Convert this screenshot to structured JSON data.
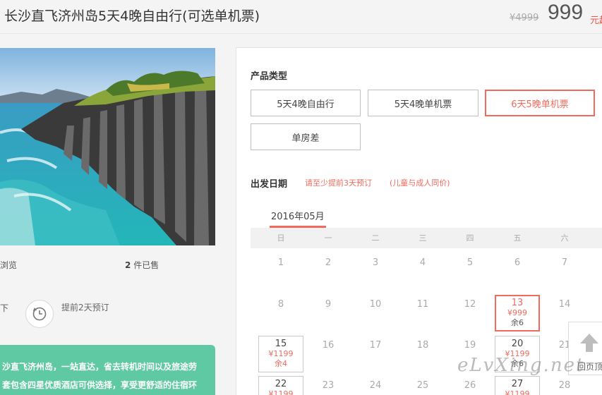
{
  "header": {
    "title": "长沙直飞济州岛5天4晚自由行(可选单机票)",
    "original_price": "¥4999",
    "price": "999",
    "price_unit": "元起"
  },
  "stats": {
    "views_label": "浏览",
    "sold_count": "2",
    "sold_label": "件已售",
    "cut_text": "下",
    "advance_text": "提前2天预订"
  },
  "description": {
    "line1": "沙直飞济州岛，一站直达，省去转机时间以及旅途劳",
    "line2": "套包含四星优质酒店可供选择，享受更舒适的住宿环"
  },
  "product": {
    "label": "产品类型",
    "options": [
      {
        "label": "5天4晚自由行",
        "selected": false
      },
      {
        "label": "5天4晚单机票",
        "selected": false
      },
      {
        "label": "6天5晚单机票",
        "selected": true
      },
      {
        "label": "单房差",
        "selected": false
      }
    ]
  },
  "departure": {
    "label": "出发日期",
    "note1": "请至少提前3天预订",
    "note2": "(儿童与成人同价)"
  },
  "calendar": {
    "month": "2016年05月",
    "weekdays": [
      "日",
      "一",
      "二",
      "三",
      "四",
      "五",
      "六"
    ],
    "days": [
      {
        "d": "1"
      },
      {
        "d": "2"
      },
      {
        "d": "3"
      },
      {
        "d": "4"
      },
      {
        "d": "5"
      },
      {
        "d": "6"
      },
      {
        "d": "7"
      },
      {
        "d": "8"
      },
      {
        "d": "9"
      },
      {
        "d": "10"
      },
      {
        "d": "11"
      },
      {
        "d": "12"
      },
      {
        "d": "13",
        "price": "¥999",
        "remain": "余6",
        "selected": true
      },
      {
        "d": "14"
      },
      {
        "d": "15",
        "price": "¥1199",
        "remain": "余4",
        "remain_red": true
      },
      {
        "d": "16"
      },
      {
        "d": "17"
      },
      {
        "d": "18"
      },
      {
        "d": "19"
      },
      {
        "d": "20",
        "price": "¥1199",
        "remain": "余6"
      },
      {
        "d": "21"
      },
      {
        "d": "22",
        "price": "¥1199"
      },
      {
        "d": "23"
      },
      {
        "d": "24"
      },
      {
        "d": "25"
      },
      {
        "d": "26"
      },
      {
        "d": "27",
        "price": "¥1199"
      },
      {
        "d": "28"
      }
    ]
  },
  "back_to_top": "回页顶",
  "watermark": "eLvXing.net",
  "colors": {
    "accent": "#ef6b5e",
    "teal": "#5ec9a2"
  }
}
